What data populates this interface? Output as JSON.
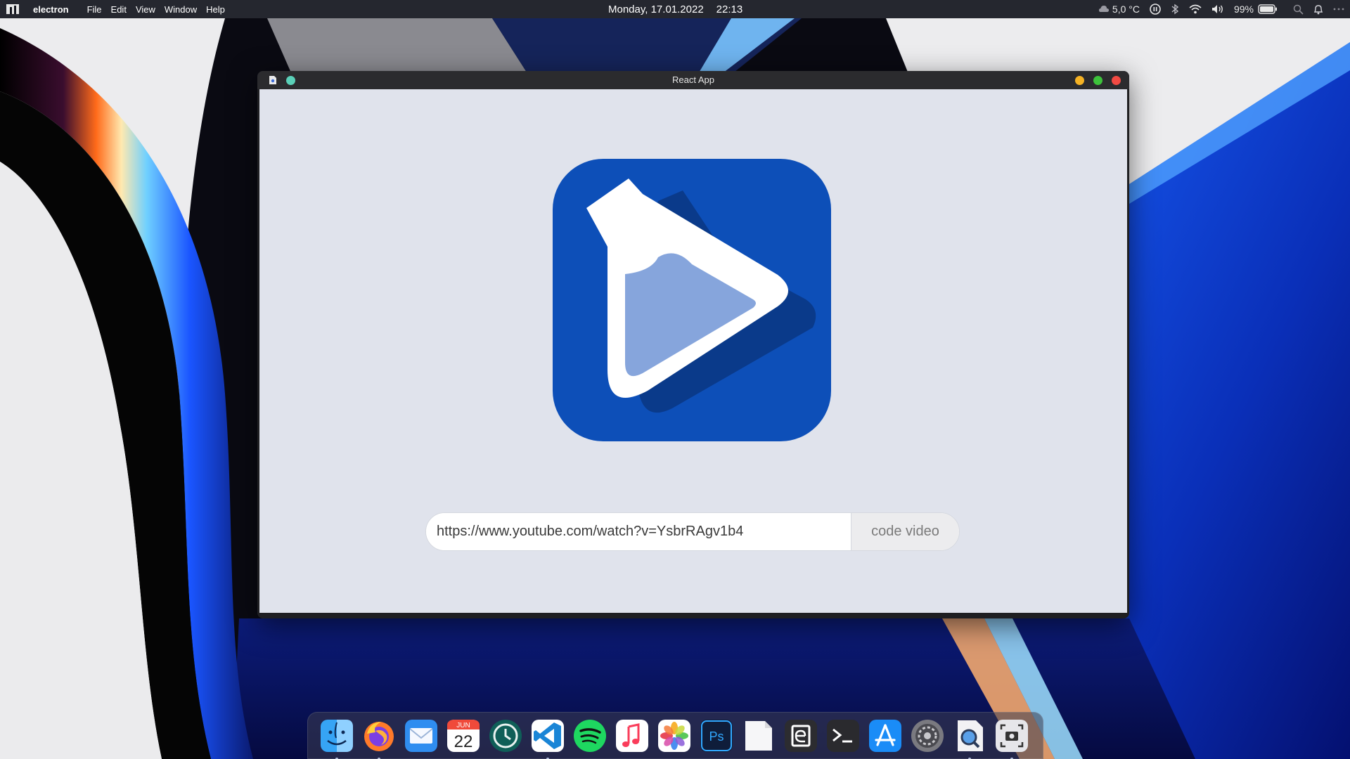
{
  "menubar": {
    "app_name": "electron",
    "menu": [
      "File",
      "Edit",
      "View",
      "Window",
      "Help"
    ],
    "date": "Monday, 17.01.2022",
    "time": "22:13",
    "weather": "5,0 °C",
    "battery": "99%"
  },
  "window": {
    "title": "React App"
  },
  "form": {
    "url_value": "https://www.youtube.com/watch?v=YsbrRAgv1b4",
    "button_label": "code video"
  },
  "dock": {
    "calendar_month": "JUN",
    "calendar_day": "22",
    "photoshop_label": "Ps",
    "items": [
      {
        "name": "finder-icon",
        "running": true
      },
      {
        "name": "firefox-icon",
        "running": true
      },
      {
        "name": "mail-icon",
        "running": false
      },
      {
        "name": "calendar-icon",
        "running": false
      },
      {
        "name": "time-machine-icon",
        "running": false
      },
      {
        "name": "vscode-icon",
        "running": true
      },
      {
        "name": "spotify-icon",
        "running": false
      },
      {
        "name": "music-icon",
        "running": false
      },
      {
        "name": "photos-icon",
        "running": false
      },
      {
        "name": "photoshop-icon",
        "running": false
      },
      {
        "name": "blank-document-icon",
        "running": false
      },
      {
        "name": "electron-e-icon",
        "running": false
      },
      {
        "name": "terminal-icon",
        "running": false
      },
      {
        "name": "app-store-icon",
        "running": false
      },
      {
        "name": "system-preferences-icon",
        "running": false
      },
      {
        "name": "preview-icon",
        "running": true
      },
      {
        "name": "screenshot-icon",
        "running": true
      }
    ]
  },
  "colors": {
    "menubar_bg": "#14161e",
    "window_content_bg": "#e0e3ec",
    "logo_blue": "#0d4fb8",
    "logo_shadow": "#0a3a8a",
    "logo_liquid": "#86a5dc"
  }
}
